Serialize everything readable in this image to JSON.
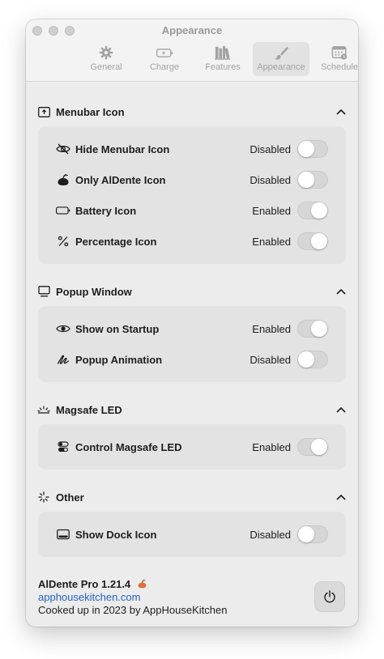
{
  "window": {
    "title": "Appearance"
  },
  "tabs": [
    {
      "label": "General",
      "icon": "gear-icon"
    },
    {
      "label": "Charge",
      "icon": "battery-charge-icon"
    },
    {
      "label": "Features",
      "icon": "books-icon"
    },
    {
      "label": "Appearance",
      "icon": "paintbrush-icon",
      "active": true
    },
    {
      "label": "Schedule",
      "icon": "calendar-icon"
    }
  ],
  "sections": [
    {
      "title": "Menubar Icon",
      "icon": "menubar-icon",
      "rows": [
        {
          "label": "Hide Menubar Icon",
          "status": "Disabled",
          "enabled": false,
          "icon": "eye-slash-icon"
        },
        {
          "label": "Only AlDente Icon",
          "status": "Disabled",
          "enabled": false,
          "icon": "aldente-logo-icon"
        },
        {
          "label": "Battery Icon",
          "status": "Enabled",
          "enabled": true,
          "icon": "battery-icon"
        },
        {
          "label": "Percentage Icon",
          "status": "Enabled",
          "enabled": true,
          "icon": "percent-icon"
        }
      ]
    },
    {
      "title": "Popup Window",
      "icon": "popup-window-icon",
      "rows": [
        {
          "label": "Show on Startup",
          "status": "Enabled",
          "enabled": true,
          "icon": "eye-icon"
        },
        {
          "label": "Popup Animation",
          "status": "Disabled",
          "enabled": false,
          "icon": "scribble-icon"
        }
      ]
    },
    {
      "title": "Magsafe LED",
      "icon": "led-glow-icon",
      "rows": [
        {
          "label": "Control Magsafe LED",
          "status": "Enabled",
          "enabled": true,
          "icon": "led-switch-icon"
        }
      ]
    },
    {
      "title": "Other",
      "icon": "sparkle-icon",
      "rows": [
        {
          "label": "Show Dock Icon",
          "status": "Disabled",
          "enabled": false,
          "icon": "dock-icon"
        }
      ]
    }
  ],
  "footer": {
    "app_name": "AlDente Pro 1.21.4",
    "link": "apphousekitchen.com",
    "cooked": "Cooked up in 2023 by AppHouseKitchen"
  },
  "colors": {
    "link": "#2563c9",
    "card": "#e3e3e3",
    "window": "#ececec"
  }
}
